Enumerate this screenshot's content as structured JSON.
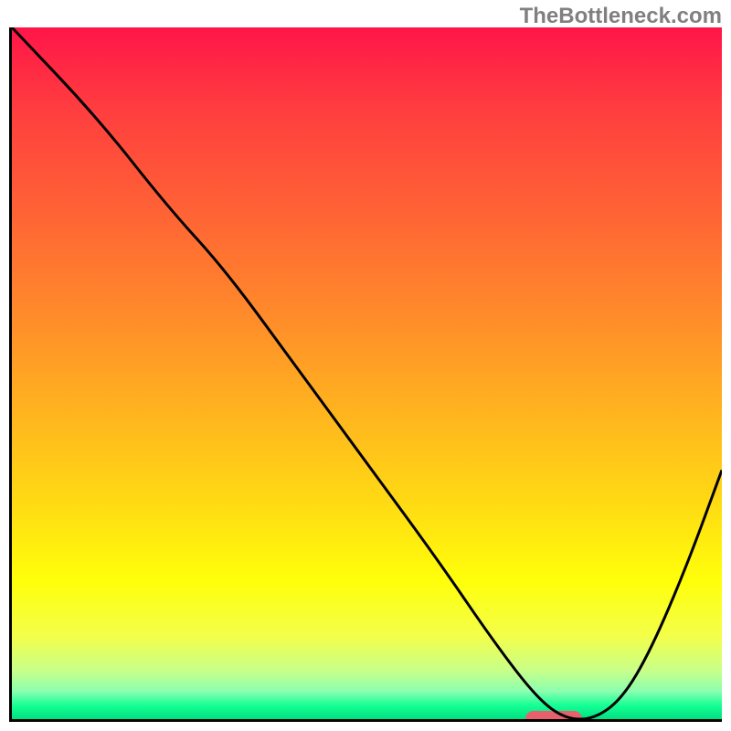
{
  "watermark": "TheBottleneck.com",
  "chart_data": {
    "type": "line",
    "title": "",
    "xlabel": "",
    "ylabel": "",
    "xlim": [
      0,
      100
    ],
    "ylim": [
      0,
      100
    ],
    "x": [
      0,
      12,
      22,
      30,
      40,
      50,
      60,
      68,
      74,
      78,
      82,
      86,
      90,
      95,
      100
    ],
    "values": [
      100,
      87,
      74,
      65,
      51,
      37,
      23,
      11,
      3,
      0,
      0,
      3,
      10,
      22,
      36
    ],
    "annotations": [
      {
        "kind": "optimal-marker",
        "x_start": 72,
        "x_end": 80,
        "y": 0,
        "color": "#e8606b"
      }
    ],
    "background_gradient": {
      "stops": [
        {
          "pct": 0,
          "color": "#ff1549"
        },
        {
          "pct": 12,
          "color": "#ff3e3f"
        },
        {
          "pct": 28,
          "color": "#ff6634"
        },
        {
          "pct": 42,
          "color": "#ff8c2a"
        },
        {
          "pct": 55,
          "color": "#ffb21f"
        },
        {
          "pct": 68,
          "color": "#ffd814"
        },
        {
          "pct": 80,
          "color": "#ffff0a"
        },
        {
          "pct": 88,
          "color": "#f3ff4a"
        },
        {
          "pct": 93,
          "color": "#c8ff8a"
        },
        {
          "pct": 96,
          "color": "#8affb0"
        },
        {
          "pct": 98,
          "color": "#15ff95"
        },
        {
          "pct": 100,
          "color": "#00e080"
        }
      ]
    }
  }
}
